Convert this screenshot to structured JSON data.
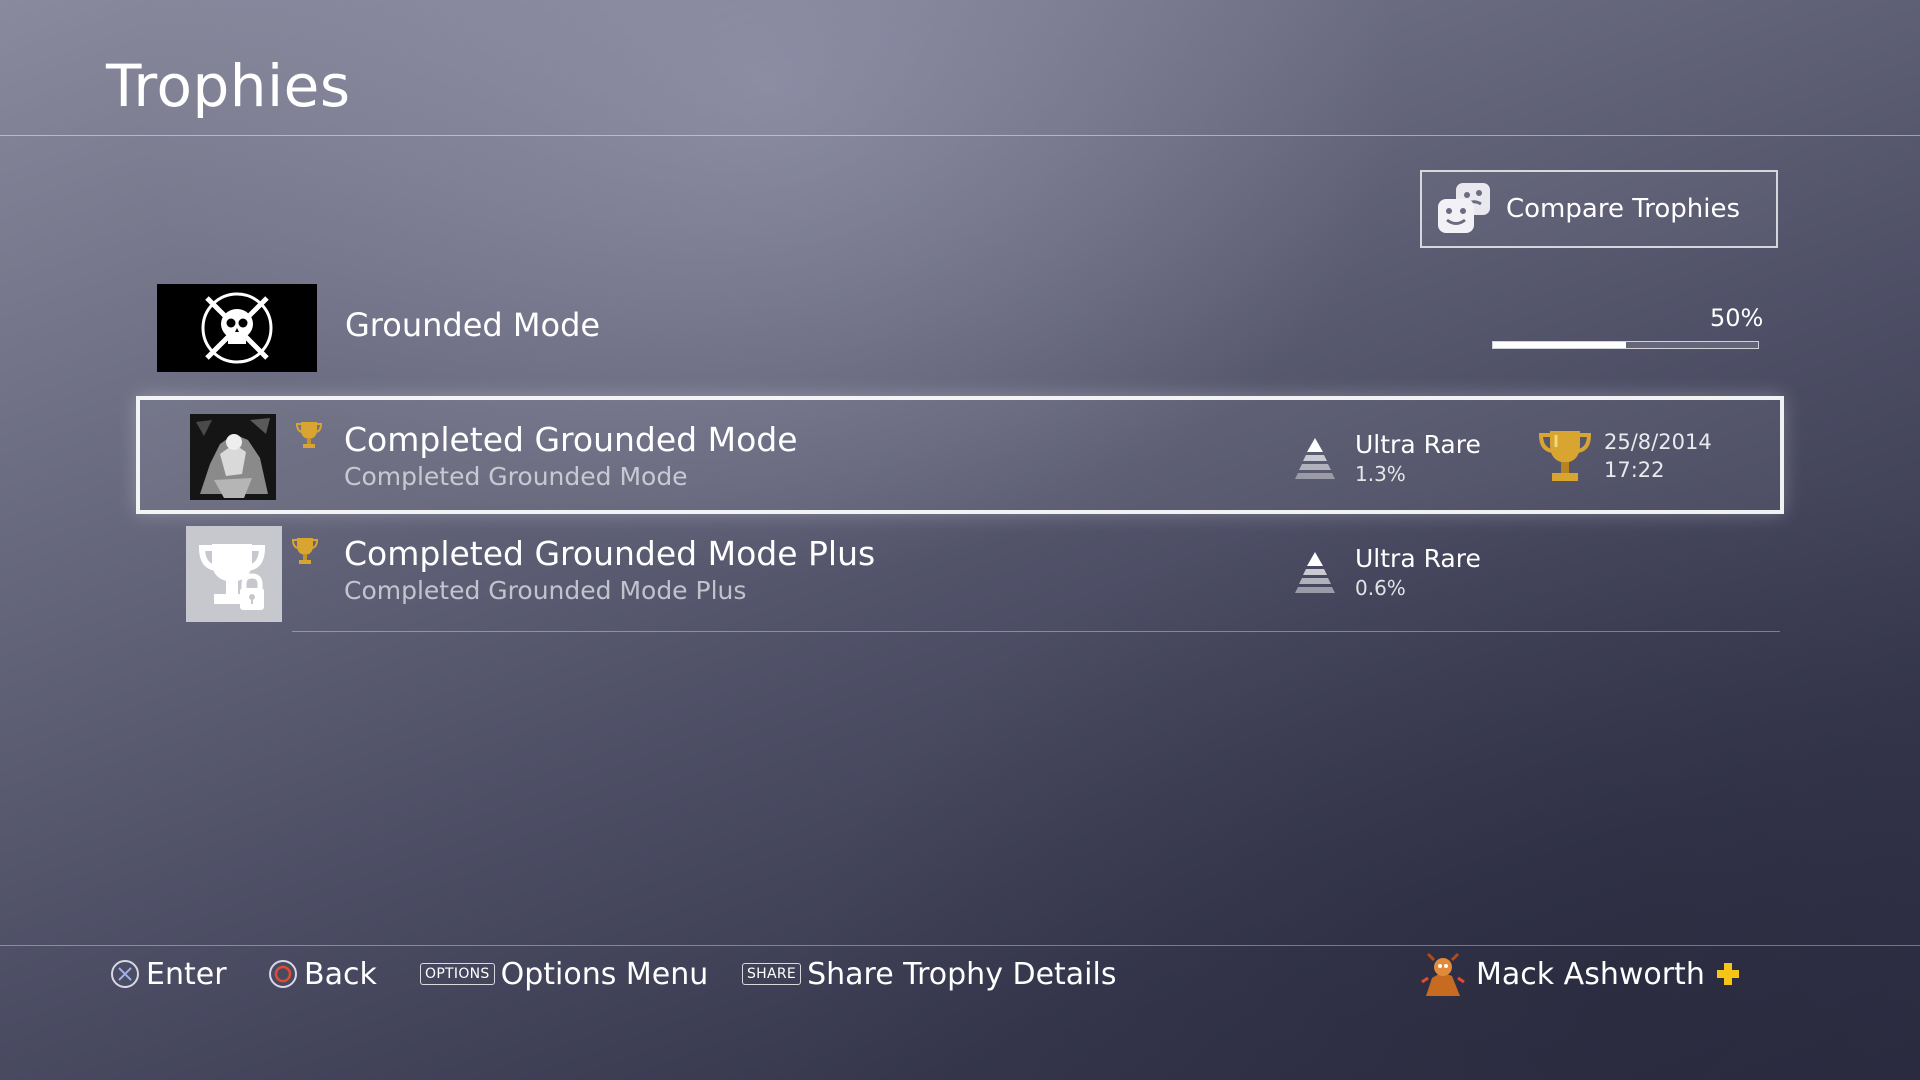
{
  "page": {
    "title": "Trophies"
  },
  "compare": {
    "label": "Compare Trophies"
  },
  "game": {
    "title": "Grounded Mode",
    "progress_label": "50%",
    "progress_fraction": 0.5
  },
  "trophies": [
    {
      "name": "Completed Grounded Mode",
      "description": "Completed Grounded Mode",
      "grade": "gold",
      "rarity": "Ultra Rare",
      "rarity_pct": "1.3%",
      "earned": true,
      "earned_date": "25/8/2014",
      "earned_time": "17:22",
      "selected": true
    },
    {
      "name": "Completed Grounded Mode Plus",
      "description": "Completed Grounded Mode Plus",
      "grade": "gold",
      "rarity": "Ultra Rare",
      "rarity_pct": "0.6%",
      "earned": false,
      "selected": false
    }
  ],
  "footer": {
    "enter_label": "Enter",
    "back_label": "Back",
    "options_key": "OPTIONS",
    "options_label": "Options Menu",
    "share_key": "SHARE",
    "share_label": "Share Trophy Details",
    "user_name": "Mack Ashworth"
  },
  "colors": {
    "gold": "#d9a531",
    "back_circle": "#e24b2f",
    "plus": "#f5c518"
  }
}
